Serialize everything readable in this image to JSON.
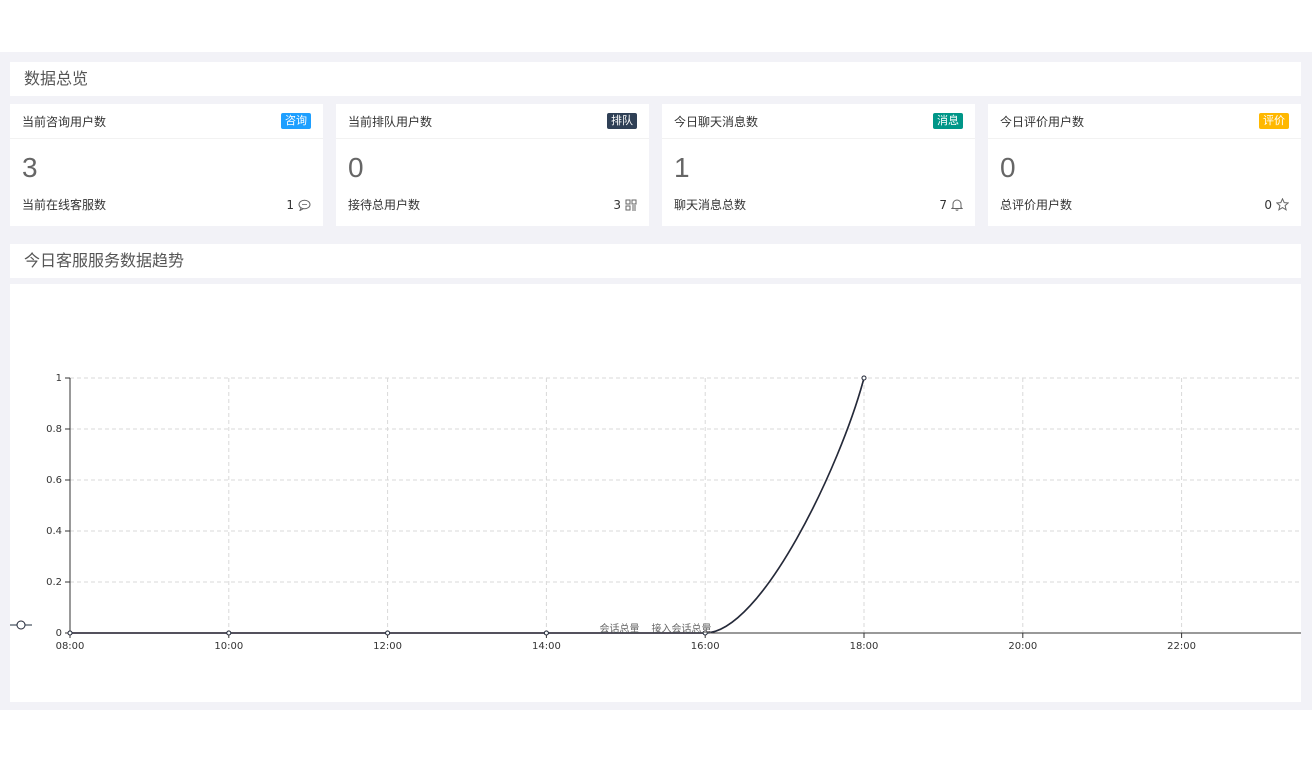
{
  "overview": {
    "title": "数据总览",
    "cards": [
      {
        "title": "当前咨询用户数",
        "badge": "咨询",
        "badge_color": "#1e9fff",
        "value": "3",
        "foot_label": "当前在线客服数",
        "foot_value": "1",
        "foot_icon": "chat-bubble-icon"
      },
      {
        "title": "当前排队用户数",
        "badge": "排队",
        "badge_color": "#2f4056",
        "value": "0",
        "foot_label": "接待总用户数",
        "foot_value": "3",
        "foot_icon": "grid-icon"
      },
      {
        "title": "今日聊天消息数",
        "badge": "消息",
        "badge_color": "#009688",
        "value": "1",
        "foot_label": "聊天消息总数",
        "foot_value": "7",
        "foot_icon": "bell-icon"
      },
      {
        "title": "今日评价用户数",
        "badge": "评价",
        "badge_color": "#ffb800",
        "value": "0",
        "foot_label": "总评价用户数",
        "foot_value": "0",
        "foot_icon": "star-icon"
      }
    ]
  },
  "trend": {
    "title": "今日客服服务数据趋势"
  },
  "chart_data": {
    "type": "line",
    "x": [
      "08:00",
      "10:00",
      "12:00",
      "14:00",
      "16:00",
      "18:00"
    ],
    "x_ticks": [
      "08:00",
      "10:00",
      "12:00",
      "14:00",
      "16:00",
      "18:00",
      "20:00",
      "22:00"
    ],
    "y_ticks": [
      "0",
      "0.2",
      "0.4",
      "0.6",
      "0.8",
      "1"
    ],
    "ylim": [
      0,
      1
    ],
    "grid": true,
    "legend_placement": "bottom",
    "series": [
      {
        "name": "会话总量",
        "color": "#f08080",
        "values": [
          0,
          0,
          0,
          0,
          0,
          1
        ]
      },
      {
        "name": "接入会话总量",
        "color": "#1f2d3d",
        "values": [
          0,
          0,
          0,
          0,
          0,
          1
        ]
      }
    ]
  }
}
